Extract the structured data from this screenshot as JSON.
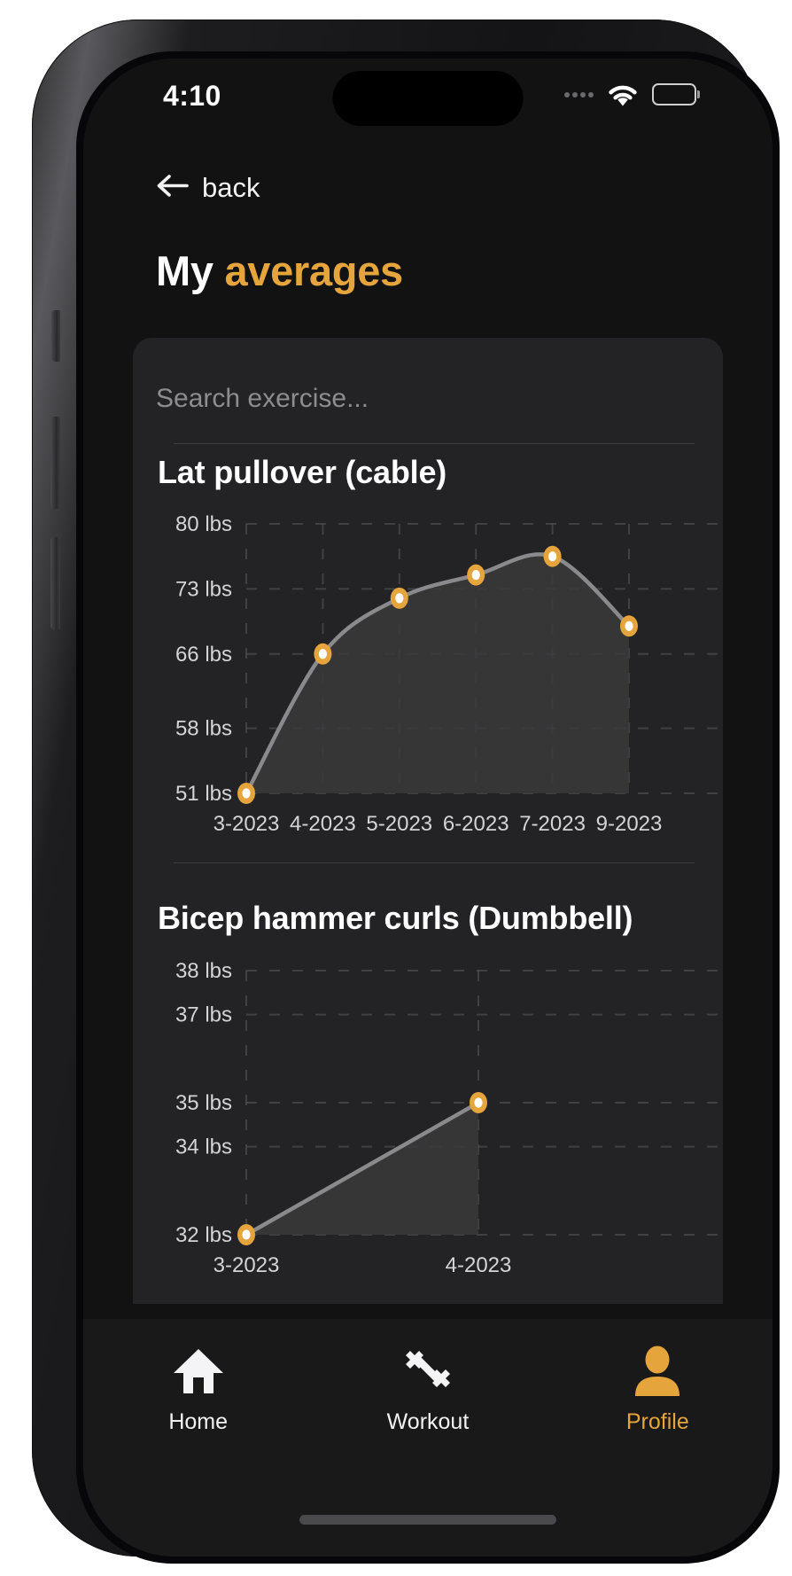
{
  "status_bar": {
    "time": "4:10",
    "signal_icon": "signal-dots-icon",
    "wifi_icon": "wifi-icon",
    "battery_icon": "battery-full-icon"
  },
  "header": {
    "back_icon": "arrow-left-icon",
    "back_label": "back",
    "title_prefix": "My ",
    "title_accent": "averages"
  },
  "search": {
    "placeholder": "Search exercise...",
    "value": ""
  },
  "colors": {
    "accent": "#e5a43c",
    "background": "#121212",
    "card": "#232325",
    "line": "#8a8a8c",
    "area": "#3a3a3c",
    "grid": "#5a5a5c",
    "text": "#ffffff",
    "muted": "#d4d4d6"
  },
  "tab_bar": {
    "items": [
      {
        "label": "Home",
        "icon": "home-icon",
        "active": false
      },
      {
        "label": "Workout",
        "icon": "dumbbell-icon",
        "active": false
      },
      {
        "label": "Profile",
        "icon": "person-icon",
        "active": true
      }
    ]
  },
  "chart_data": [
    {
      "type": "area",
      "title": "Lat pullover (cable)",
      "xlabel": "",
      "ylabel": "",
      "unit": "lbs",
      "grid": true,
      "legend": "none",
      "categories": [
        "3-2023",
        "4-2023",
        "5-2023",
        "6-2023",
        "7-2023",
        "9-2023"
      ],
      "values": [
        51,
        66,
        72,
        74.5,
        76.5,
        69
      ],
      "ytick_values": [
        80,
        73,
        66,
        58,
        51
      ],
      "ytick_labels": [
        "80 lbs",
        "73 lbs",
        "66 lbs",
        "58 lbs",
        "51 lbs"
      ],
      "ylim": [
        51,
        80
      ],
      "point_marker": "orange-dot"
    },
    {
      "type": "area",
      "title": "Bicep hammer curls (Dumbbell)",
      "xlabel": "",
      "ylabel": "",
      "unit": "lbs",
      "grid": true,
      "legend": "none",
      "categories": [
        "3-2023",
        "4-2023"
      ],
      "values": [
        32,
        35
      ],
      "ytick_values": [
        38,
        37,
        35,
        34,
        32
      ],
      "ytick_labels": [
        "38 lbs",
        "37 lbs",
        "35 lbs",
        "34 lbs",
        "32 lbs"
      ],
      "ylim": [
        32,
        38
      ],
      "point_marker": "orange-dot"
    }
  ]
}
